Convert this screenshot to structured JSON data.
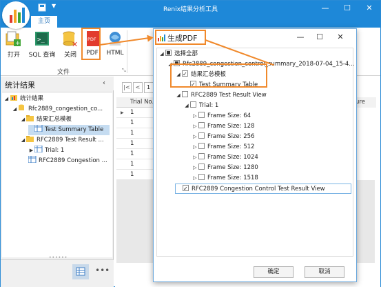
{
  "app": {
    "title": "Renix结果分析工具",
    "tab_home": "主页",
    "window_controls": {
      "minimize": "—",
      "maximize": "☐",
      "close": "✕"
    }
  },
  "ribbon": {
    "buttons": [
      {
        "label": "打开",
        "icon": "open-folder-icon"
      },
      {
        "label": "SQL 查询",
        "icon": "sql-query-icon"
      },
      {
        "label": "关闭",
        "icon": "close-db-icon"
      },
      {
        "label": "PDF",
        "icon": "pdf-icon"
      },
      {
        "label": "HTML",
        "icon": "html-icon"
      }
    ],
    "group_label": "文件"
  },
  "left_panel": {
    "title": "统计结果",
    "tree": [
      {
        "label": "统计结果",
        "level": 0
      },
      {
        "label": "Rfc2889_congestion_co...",
        "level": 1
      },
      {
        "label": "结果汇总模板",
        "level": 2
      },
      {
        "label": "Test Summary Table",
        "level": 3
      },
      {
        "label": "RFC2889 Test Result ...",
        "level": 2
      },
      {
        "label": "Trial: 1",
        "level": 3
      },
      {
        "label": "RFC2889 Congestion ...",
        "level": 2
      }
    ]
  },
  "main": {
    "pager": {
      "first": "|<",
      "prev": "<",
      "page": "1"
    },
    "grid_header": "Trial No.",
    "right_header": "ure",
    "rows": [
      "1",
      "1",
      "1",
      "1",
      "1",
      "1",
      "1"
    ]
  },
  "dialog": {
    "title": "生成PDF",
    "win_controls": {
      "minimize": "—",
      "maximize": "☐",
      "close": "✕"
    },
    "tree": [
      {
        "label": "选择全部"
      },
      {
        "label": "Rfc2889_congestion_control_summary_2018-07-04_15-4..."
      },
      {
        "label": "结果汇总模板"
      },
      {
        "label": "Test Summary Table"
      },
      {
        "label": "RFC2889 Test Result View"
      },
      {
        "label": "Trial: 1"
      },
      {
        "label": "Frame Size: 64"
      },
      {
        "label": "Frame Size: 128"
      },
      {
        "label": "Frame Size: 256"
      },
      {
        "label": "Frame Size: 512"
      },
      {
        "label": "Frame Size: 1024"
      },
      {
        "label": "Frame Size: 1280"
      },
      {
        "label": "Frame Size: 1518"
      },
      {
        "label": "RFC2889 Congestion Control Test Result View"
      }
    ],
    "ok_label": "确定",
    "cancel_label": "取消"
  },
  "colors": {
    "accent": "#1e88d8",
    "annotation": "#f0892b"
  }
}
